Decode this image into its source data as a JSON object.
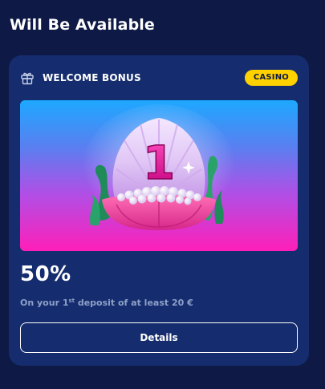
{
  "section": {
    "title": "Will Be Available"
  },
  "card": {
    "icon": "gift-icon",
    "label": "WELCOME BONUS",
    "tag": "CASINO",
    "tag_color": "#ffd100",
    "banner": {
      "number": "1",
      "illustration": "pearl-shell"
    },
    "amount": "50%",
    "description": {
      "before": "On your 1",
      "superscript": "st",
      "after": " deposit of at least 20 €"
    },
    "button_label": "Details"
  },
  "colors": {
    "background": "#0e1a45",
    "card": "#152d6e",
    "muted_text": "#8ea0c8",
    "accent": "#ff1fb8"
  }
}
